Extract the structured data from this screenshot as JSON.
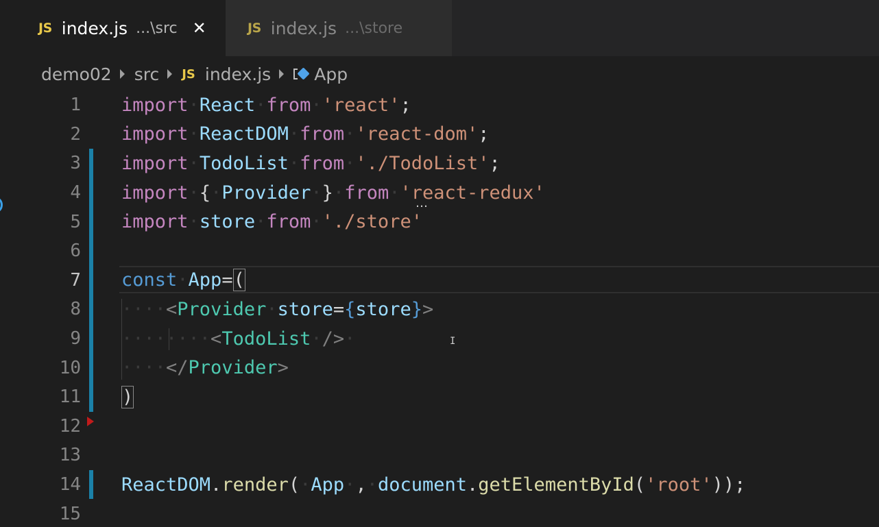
{
  "tabs": [
    {
      "js_badge": "JS",
      "name": "index.js",
      "path": "...\\src",
      "close": "✕"
    },
    {
      "js_badge": "JS",
      "name": "index.js",
      "path": "...\\store"
    }
  ],
  "breadcrumb": {
    "items": [
      "demo02",
      "src",
      "index.js",
      "App"
    ],
    "js_badge": "JS"
  },
  "code": {
    "lines": [
      {
        "n": "1",
        "tokens": [
          [
            "k-import",
            "import"
          ],
          [
            "ws",
            "·"
          ],
          [
            "var",
            "React"
          ],
          [
            "ws",
            "·"
          ],
          [
            "k-import",
            "from"
          ],
          [
            "ws",
            "·"
          ],
          [
            "str",
            "'react'"
          ],
          [
            "punc",
            ";"
          ]
        ]
      },
      {
        "n": "2",
        "tokens": [
          [
            "k-import",
            "import"
          ],
          [
            "ws",
            "·"
          ],
          [
            "var",
            "ReactDOM"
          ],
          [
            "ws",
            "·"
          ],
          [
            "k-import",
            "from"
          ],
          [
            "ws",
            "·"
          ],
          [
            "str",
            "'react-dom'"
          ],
          [
            "punc",
            ";"
          ]
        ]
      },
      {
        "n": "3",
        "tokens": [
          [
            "k-import",
            "import"
          ],
          [
            "ws",
            "·"
          ],
          [
            "var",
            "TodoList"
          ],
          [
            "ws",
            "·"
          ],
          [
            "k-import",
            "from"
          ],
          [
            "ws",
            "·"
          ],
          [
            "str",
            "'./TodoList'"
          ],
          [
            "punc",
            ";"
          ]
        ]
      },
      {
        "n": "4",
        "tokens": [
          [
            "k-import",
            "import"
          ],
          [
            "ws",
            "·"
          ],
          [
            "brace",
            "{"
          ],
          [
            "ws",
            "·"
          ],
          [
            "var",
            "Provider"
          ],
          [
            "ws",
            "·"
          ],
          [
            "brace",
            "}"
          ],
          [
            "ws",
            "·"
          ],
          [
            "k-import",
            "from"
          ],
          [
            "ws",
            "·"
          ],
          [
            "str",
            "'react-redux'"
          ]
        ]
      },
      {
        "n": "5",
        "tokens": [
          [
            "k-import",
            "import"
          ],
          [
            "ws",
            "·"
          ],
          [
            "var",
            "store"
          ],
          [
            "ws",
            "·"
          ],
          [
            "k-import",
            "from"
          ],
          [
            "ws",
            "·"
          ],
          [
            "str",
            "'./store'"
          ]
        ]
      },
      {
        "n": "6",
        "tokens": []
      },
      {
        "n": "7",
        "tokens": [
          [
            "k-const",
            "const"
          ],
          [
            "ws",
            "·"
          ],
          [
            "var",
            "App"
          ],
          [
            "punc",
            "="
          ],
          [
            "paren",
            "("
          ]
        ]
      },
      {
        "n": "8",
        "tokens": [
          [
            "ws",
            "····"
          ],
          [
            "tagp",
            "<"
          ],
          [
            "tag",
            "Provider"
          ],
          [
            "ws",
            "·"
          ],
          [
            "attr",
            "store"
          ],
          [
            "punc",
            "="
          ],
          [
            "jsxbrace",
            "{"
          ],
          [
            "var",
            "store"
          ],
          [
            "jsxbrace",
            "}"
          ],
          [
            "tagp",
            ">"
          ]
        ]
      },
      {
        "n": "9",
        "tokens": [
          [
            "ws",
            "········"
          ],
          [
            "tagp",
            "<"
          ],
          [
            "tag",
            "TodoList"
          ],
          [
            "ws",
            "·"
          ],
          [
            "tagp",
            "/>"
          ],
          [
            "ws",
            "·"
          ]
        ]
      },
      {
        "n": "10",
        "tokens": [
          [
            "ws",
            "····"
          ],
          [
            "tagp",
            "</"
          ],
          [
            "tag",
            "Provider"
          ],
          [
            "tagp",
            ">"
          ]
        ]
      },
      {
        "n": "11",
        "tokens": [
          [
            "paren",
            ")"
          ]
        ]
      },
      {
        "n": "12",
        "tokens": []
      },
      {
        "n": "13",
        "tokens": []
      },
      {
        "n": "14",
        "tokens": [
          [
            "var",
            "ReactDOM"
          ],
          [
            "punc",
            "."
          ],
          [
            "fn",
            "render"
          ],
          [
            "punc",
            "("
          ],
          [
            "ws",
            "·"
          ],
          [
            "var",
            "App"
          ],
          [
            "ws",
            "·"
          ],
          [
            "punc",
            ","
          ],
          [
            "ws",
            "·"
          ],
          [
            "var",
            "document"
          ],
          [
            "punc",
            "."
          ],
          [
            "fn",
            "getElementById"
          ],
          [
            "punc",
            "("
          ],
          [
            "str",
            "'root'"
          ],
          [
            "punc",
            "));"
          ]
        ]
      },
      {
        "n": "15",
        "tokens": []
      }
    ],
    "dirty_lines": [
      "3",
      "4",
      "5",
      "6",
      "7",
      "8",
      "9",
      "10",
      "11",
      "14"
    ],
    "current_line": "7",
    "breakpoint_line": "12"
  },
  "colors": {
    "background": "#1e1e1e",
    "tab_active": "#1e1e1e",
    "tab_inactive": "#2d2d2d",
    "dirty_bar": "#1b81a8",
    "js_badge": "#e8c84a"
  }
}
